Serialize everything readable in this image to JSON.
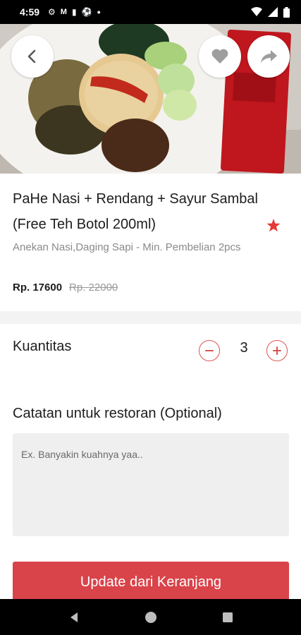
{
  "status_bar": {
    "time": "4:59",
    "icons": [
      "settings-icon",
      "gmail-icon",
      "sim-icon",
      "soccer-icon",
      "dot-icon"
    ],
    "right_icons": [
      "wifi-icon",
      "signal-icon",
      "battery-icon"
    ]
  },
  "hero": {
    "back_icon": "chevron-left-icon",
    "favorite_icon": "heart-icon",
    "share_icon": "share-icon"
  },
  "product": {
    "title": "PaHe Nasi + Rendang + Sayur Sambal (Free Teh Botol 200ml)",
    "subtitle": "Anekan Nasi,Daging Sapi - Min. Pembelian 2pcs",
    "price": "Rp. 17600",
    "old_price": "Rp. 22000",
    "favorite_star_color": "#e53935"
  },
  "quantity": {
    "label": "Kuantitas",
    "value": "3",
    "minus_icon": "minus-icon",
    "plus_icon": "plus-icon"
  },
  "notes": {
    "label": "Catatan untuk restoran (Optional)",
    "placeholder": "Ex. Banyakin kuahnya yaa.."
  },
  "actions": {
    "update_label": "Update dari Keranjang",
    "accent_color": "#d9434a"
  },
  "nav_bar": {
    "icons": [
      "back-triangle-icon",
      "home-circle-icon",
      "recents-square-icon"
    ]
  }
}
